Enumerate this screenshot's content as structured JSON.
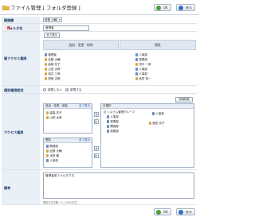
{
  "header": {
    "title": "ファイル管理 [ フォルダ登録 ]",
    "ok_label": "OK",
    "back_label": "戻る"
  },
  "parent_folder": {
    "label": "親階層",
    "value": "総務 大輔"
  },
  "folder_name": {
    "label": "フォルダ名",
    "value": "管理者"
  },
  "full_access": {
    "label": "親アクセス権限",
    "all_button": "全て表示",
    "col_left_title": "追加・変更・削除",
    "col_right_title": "閲覧",
    "left_items": [
      "管理者",
      "近藤 大輔",
      "高橋 花子",
      "山田 太郎",
      "桜井 三郎",
      "飛鳥 正樹"
    ],
    "right_items": [
      "人事部",
      "営業部",
      "田中 一郎",
      "人事部",
      "人事部",
      "品質 祐一"
    ]
  },
  "individual": {
    "label": "個別権限設定",
    "opt_off": "制限しない",
    "opt_on": "制限する"
  },
  "access": {
    "label": "アクセス権限",
    "details_button": "詳細検索",
    "edit_title": "追加・変更・削除",
    "edit_all": "全て表示",
    "edit_items": [
      "高橋 花子",
      "山田 太郎"
    ],
    "view_title": "閲覧",
    "view_all": "全て表示",
    "view_items": [
      "開発部",
      "近藤 大輔",
      "米田 隆",
      "人事部"
    ],
    "select_title": "未選択",
    "select_group": "システム管理グループ",
    "select_items": [
      "人事部",
      "営業部",
      "開発部",
      "総務部"
    ],
    "select_right": [
      "人事部",
      "飯田 京子"
    ]
  },
  "notes": {
    "label": "備考",
    "value": "管理者用フォルダです。",
    "counter": "現在の文字数: 11 / 1000文字"
  }
}
